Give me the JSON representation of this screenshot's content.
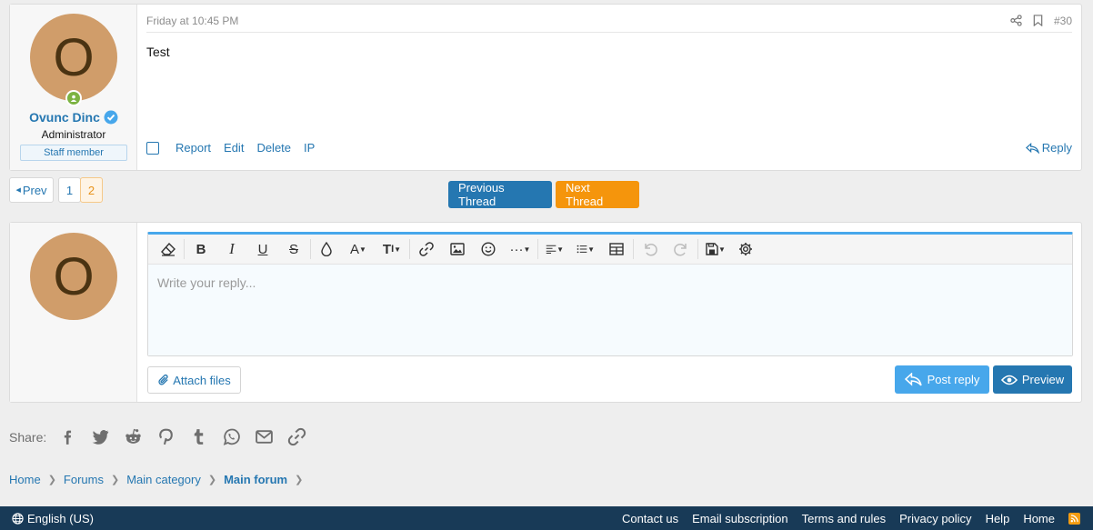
{
  "post": {
    "user": {
      "avatar_letter": "O",
      "name": "Ovunc Dinc",
      "title": "Administrator",
      "badge": "Staff member"
    },
    "date": "Friday at 10:45 PM",
    "number": "#30",
    "content": "Test",
    "actions": [
      "Report",
      "Edit",
      "Delete",
      "IP"
    ],
    "reply_label": "Reply"
  },
  "pagination": {
    "prev_label": "Prev",
    "pages": [
      "1",
      "2"
    ],
    "current": "2"
  },
  "thread_nav": {
    "previous": "Previous Thread",
    "next": "Next Thread"
  },
  "quick_reply": {
    "avatar_letter": "O",
    "placeholder": "Write your reply...",
    "attach_label": "Attach files",
    "post_reply_label": "Post reply",
    "preview_label": "Preview"
  },
  "share": {
    "label": "Share:",
    "icons": [
      "facebook-icon",
      "twitter-icon",
      "reddit-icon",
      "pinterest-icon",
      "tumblr-icon",
      "whatsapp-icon",
      "email-icon",
      "link-icon"
    ]
  },
  "breadcrumb": [
    "Home",
    "Forums",
    "Main category",
    "Main forum"
  ],
  "footer": {
    "language": "English (US)",
    "links": [
      "Contact us",
      "Email subscription",
      "Terms and rules",
      "Privacy policy",
      "Help",
      "Home"
    ]
  },
  "colors": {
    "accent": "#2577b1",
    "next_thread": "#f5950c",
    "post_reply": "#47a7eb",
    "footer": "#183a57",
    "avatar": "#d09d6a"
  }
}
